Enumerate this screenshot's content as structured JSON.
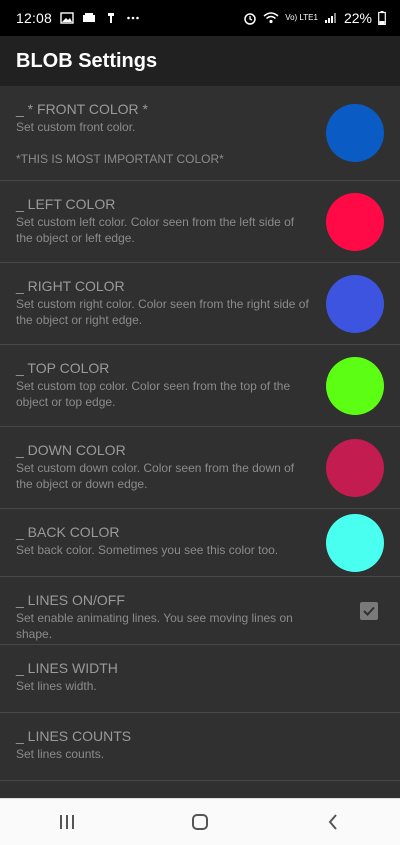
{
  "status": {
    "time": "12:08",
    "battery": "22%",
    "network": "Vo) LTE1",
    "icons_left": [
      "image-icon",
      "message-icon",
      "usb-icon",
      "more-icon"
    ],
    "icons_right": [
      "alarm-icon",
      "wifi-icon",
      "signal-icon",
      "battery-icon"
    ]
  },
  "app": {
    "title": "BLOB Settings"
  },
  "prefs": [
    {
      "title": "_ * FRONT COLOR *",
      "summary": "Set custom front color.\n\n*THIS IS MOST IMPORTANT COLOR*",
      "swatch": "#0a5cc4",
      "widget": "color"
    },
    {
      "title": "_ LEFT COLOR",
      "summary": "Set custom left color. Color seen from the left side of the object or left edge.",
      "swatch": "#ff0a47",
      "widget": "color"
    },
    {
      "title": "_ RIGHT COLOR",
      "summary": "Set custom right color. Color seen from the right side of the object or right edge.",
      "swatch": "#3c54e0",
      "widget": "color"
    },
    {
      "title": "_ TOP COLOR",
      "summary": "Set custom top color. Color seen from the top of the object or top edge.",
      "swatch": "#5cff14",
      "widget": "color"
    },
    {
      "title": "_ DOWN COLOR",
      "summary": "Set custom down color. Color seen from the down of the object or down edge.",
      "swatch": "#c21c50",
      "widget": "color"
    },
    {
      "title": "_ BACK COLOR",
      "summary": "Set back color. Sometimes you see this color too.",
      "swatch": "#48fff0",
      "widget": "color"
    },
    {
      "title": "_ LINES ON/OFF",
      "summary": "Set enable animating lines. You see moving lines on shape.",
      "checked": true,
      "widget": "checkbox"
    },
    {
      "title": "_ LINES WIDTH",
      "summary": "Set lines width.",
      "widget": "none"
    },
    {
      "title": "_ LINES COUNTS",
      "summary": "Set lines counts.",
      "widget": "none"
    }
  ],
  "nav": {
    "items": [
      "recent-apps-icon",
      "home-icon",
      "back-icon"
    ]
  }
}
